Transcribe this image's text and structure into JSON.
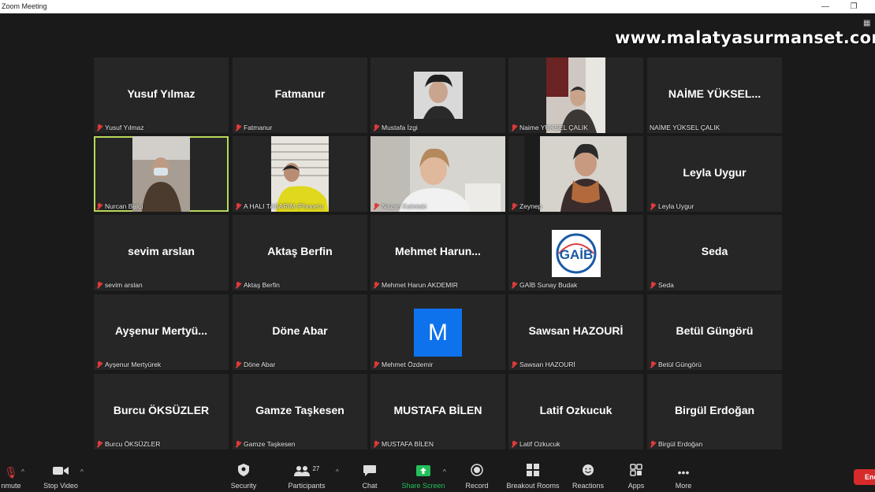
{
  "window": {
    "title": "Zoom Meeting",
    "minimize_glyph": "—",
    "restore_glyph": "❐"
  },
  "watermark": "www.malatyasurmanset.com",
  "view_icon": "grid-view-icon",
  "participants": [
    {
      "big": "Yusuf Yılmaz",
      "caption": "Yusuf Yılmaz"
    },
    {
      "big": "Fatmanur",
      "caption": "Fatmanur"
    },
    {
      "big": "",
      "caption": "Mustafa İzgi",
      "video": "avatar-photo"
    },
    {
      "big": "",
      "caption": "Naime YÜKSEL ÇALIK",
      "video": "camera-feed"
    },
    {
      "big": "NAİME YÜKSEL...",
      "caption": "NAİME YÜKSEL ÇALIK"
    },
    {
      "big": "",
      "caption": "Nurcan Balcı",
      "video": "camera-feed",
      "active_speaker": true
    },
    {
      "big": "",
      "caption": "A HALI TASARIM iPhone'u",
      "video": "camera-feed"
    },
    {
      "big": "",
      "caption": "Nazan Kaletaki",
      "video": "camera-feed"
    },
    {
      "big": "",
      "caption": "Zeynep",
      "video": "camera-feed"
    },
    {
      "big": "Leyla Uygur",
      "caption": "Leyla Uygur"
    },
    {
      "big": "sevim arslan",
      "caption": "sevim arslan"
    },
    {
      "big": "Aktaş Berfin",
      "caption": "Aktaş Berfin"
    },
    {
      "big": "Mehmet  Harun...",
      "caption": "Mehmet Harun AKDEMIR"
    },
    {
      "big": "",
      "caption": "GAİB Sunay Budak",
      "video": "logo",
      "logo_text": "GAİB"
    },
    {
      "big": "Seda",
      "caption": "Seda"
    },
    {
      "big": "Ayşenur  Mertyü...",
      "caption": "Ayşenur Mertyürek"
    },
    {
      "big": "Döne Abar",
      "caption": "Döne Abar"
    },
    {
      "big": "",
      "caption": "Mehmet Özdemir",
      "video": "initial",
      "initial": "M"
    },
    {
      "big": "Sawsan HAZOURİ",
      "caption": "Sawsan HAZOURİ"
    },
    {
      "big": "Betül Güngörü",
      "caption": "Betül Güngörü"
    },
    {
      "big": "Burcu ÖKSÜZLER",
      "caption": "Burcu ÖKSÜZLER"
    },
    {
      "big": "Gamze Taşkesen",
      "caption": "Gamze Taşkesen"
    },
    {
      "big": "MUSTAFA BİLEN",
      "caption": "MUSTAFA BİLEN"
    },
    {
      "big": "Latif Ozkucuk",
      "caption": "Latif Ozkucuk"
    },
    {
      "big": "Birgül Erdoğan",
      "caption": "Birgül Erdoğan"
    }
  ],
  "toolbar": {
    "unmute": "nmute",
    "stop_video": "Stop Video",
    "security": "Security",
    "participants": "Participants",
    "participants_count": "27",
    "chat": "Chat",
    "share_screen": "Share Screen",
    "record": "Record",
    "breakout_rooms": "Breakout Rooms",
    "reactions": "Reactions",
    "apps": "Apps",
    "more": "More",
    "end": "End"
  },
  "colors": {
    "background": "#1a1a1a",
    "tile": "#262626",
    "active_speaker_border": "#b8d85a",
    "muted_mic": "#e03a3a",
    "share_screen": "#23c05a",
    "end_button": "#d72b2b",
    "initial_avatar": "#0e72ed"
  }
}
